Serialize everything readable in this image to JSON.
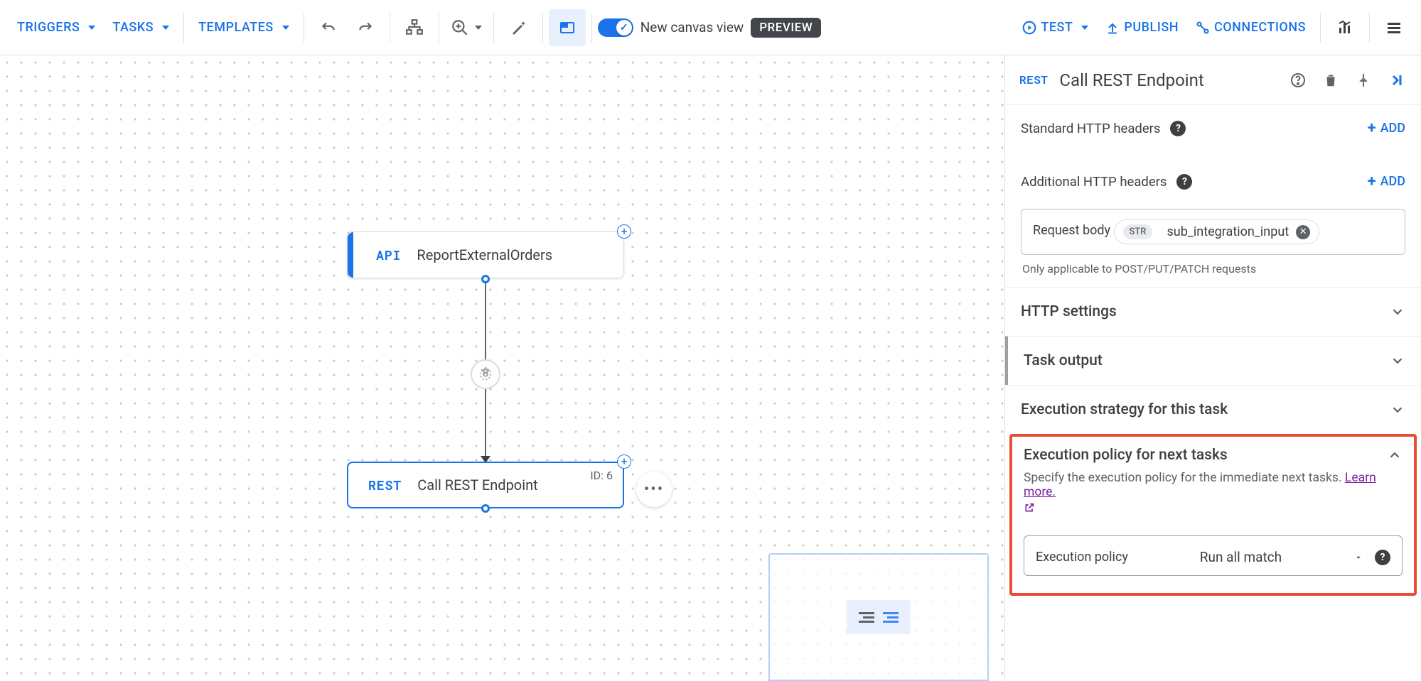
{
  "toolbar": {
    "triggers": "TRIGGERS",
    "tasks": "TASKS",
    "templates": "TEMPLATES",
    "canvas_label": "New canvas view",
    "preview_chip": "PREVIEW",
    "test": "TEST",
    "publish": "PUBLISH",
    "connections": "CONNECTIONS"
  },
  "canvas": {
    "api_node": {
      "badge": "API",
      "title": "ReportExternalOrders"
    },
    "rest_node": {
      "badge": "REST",
      "title": "Call REST Endpoint",
      "id_label": "ID: 6"
    }
  },
  "panel": {
    "header_badge": "REST",
    "header_title": "Call REST Endpoint",
    "std_headers_label": "Standard HTTP headers",
    "add_label": "ADD",
    "addl_headers_label": "Additional HTTP headers",
    "request_body_legend": "Request body",
    "str_chip": "STR",
    "request_body_var": "sub_integration_input",
    "request_body_helper": "Only applicable to POST/PUT/PATCH requests",
    "http_settings_title": "HTTP settings",
    "task_output_title": "Task output",
    "exec_strategy_title": "Execution strategy for this task",
    "exec_policy_title": "Execution policy for next tasks",
    "exec_policy_desc": "Specify the execution policy for the immediate next tasks. ",
    "learn_more": "Learn more.",
    "policy_legend": "Execution policy",
    "policy_value": "Run all match"
  }
}
